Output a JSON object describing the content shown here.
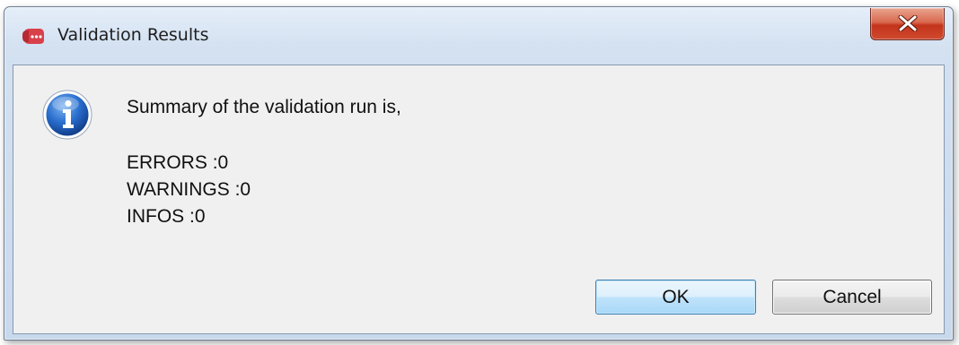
{
  "window": {
    "title": "Validation Results",
    "close_glyph": "X"
  },
  "icons": {
    "app": "app-logo-icon",
    "message": "info-icon",
    "close": "close-icon"
  },
  "message": {
    "summary": "Summary of the validation run is,",
    "stats": [
      {
        "label": "ERRORS",
        "value": "0"
      },
      {
        "label": "WARNINGS",
        "value": "0"
      },
      {
        "label": "INFOS",
        "value": "0"
      }
    ]
  },
  "buttons": {
    "ok_label": "OK",
    "cancel_label": "Cancel"
  },
  "colors": {
    "client_bg": "#f0f0f0",
    "close_button": "#c3331b",
    "default_button": "#a8d8f8",
    "info_blue": "#1d5fb5"
  }
}
